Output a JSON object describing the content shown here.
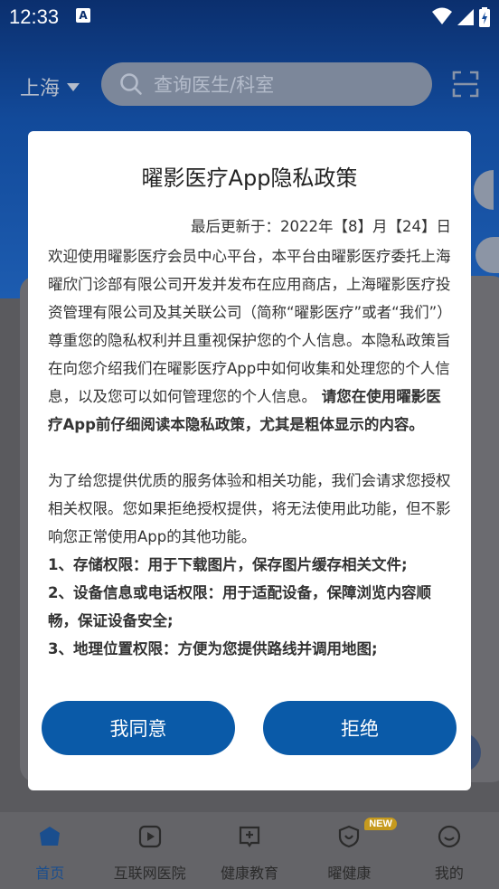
{
  "status_bar": {
    "time": "12:33",
    "notification_icon": "A"
  },
  "header": {
    "city": "上海",
    "search_placeholder": "查询医生/科室"
  },
  "dialog": {
    "title": "曜影医疗App隐私政策",
    "updated": "最后更新于：2022年【8】月【24】日",
    "intro_text": "欢迎使用曜影医疗会员中心平台，本平台由曜影医疗委托上海曜欣门诊部有限公司开发并发布在应用商店，上海曜影医疗投资管理有限公司及其关联公司（简称“曜影医疗”或者“我们”）尊重您的隐私权利并且重视保护您的个人信息。本隐私政策旨在向您介绍我们在曜影医疗App中如何收集和处理您的个人信息，以及您可以如何管理您的个人信息。",
    "intro_bold": " 请您在使用曜影医疗App前仔细阅读本隐私政策，尤其是粗体显示的内容。",
    "permissions_intro": "为了给您提供优质的服务体验和相关功能，我们会请求您授权相关权限。您如果拒绝授权提供，将无法使用此功能，但不影响您正常使用App的其他功能。",
    "permission_items": [
      "1、存储权限：用于下载图片，保存图片缓存相关文件;",
      "2、设备信息或电话权限：用于适配设备，保障浏览内容顺畅，保证设备安全;",
      "3、地理位置权限：方便为您提供路线并调用地图;"
    ],
    "agree_label": "我同意",
    "reject_label": "拒绝"
  },
  "nav": {
    "items": [
      {
        "label": "首页",
        "icon": "home-icon",
        "active": true
      },
      {
        "label": "互联网医院",
        "icon": "video-play-icon",
        "active": false
      },
      {
        "label": "健康教育",
        "icon": "book-icon",
        "active": false
      },
      {
        "label": "曜健康",
        "icon": "shield-icon",
        "active": false,
        "badge": "NEW"
      },
      {
        "label": "我的",
        "icon": "profile-icon",
        "active": false
      }
    ]
  },
  "colors": {
    "primary": "#0a5aa8",
    "header_bg": "#124a9a",
    "badge": "#c69a1e"
  }
}
